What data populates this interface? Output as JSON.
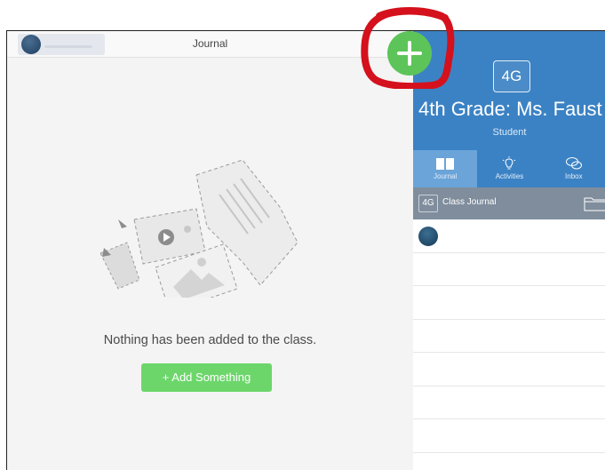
{
  "topbar": {
    "title": "Journal",
    "avatar_icon": "user-avatar-blurred"
  },
  "empty_state": {
    "illustration_icon": "media-collage-illustration",
    "message": "Nothing has been added to the class.",
    "add_button_label": "+ Add Something"
  },
  "add_button": {
    "icon": "plus-icon",
    "color": "#5dc45a"
  },
  "class_panel": {
    "badge": "4G",
    "name": "4th Grade: Ms. Faust",
    "role": "Student",
    "header_color": "#3b82c4"
  },
  "tabs": [
    {
      "label": "Journal",
      "icon": "book-icon",
      "active": true
    },
    {
      "label": "Activities",
      "icon": "lightbulb-icon",
      "active": false
    },
    {
      "label": "Inbox",
      "icon": "chat-bubbles-icon",
      "active": false
    }
  ],
  "class_journal": {
    "badge": "4G",
    "label": "Class Journal",
    "icon": "folder-icon"
  },
  "annotation_color": "#d4111c"
}
